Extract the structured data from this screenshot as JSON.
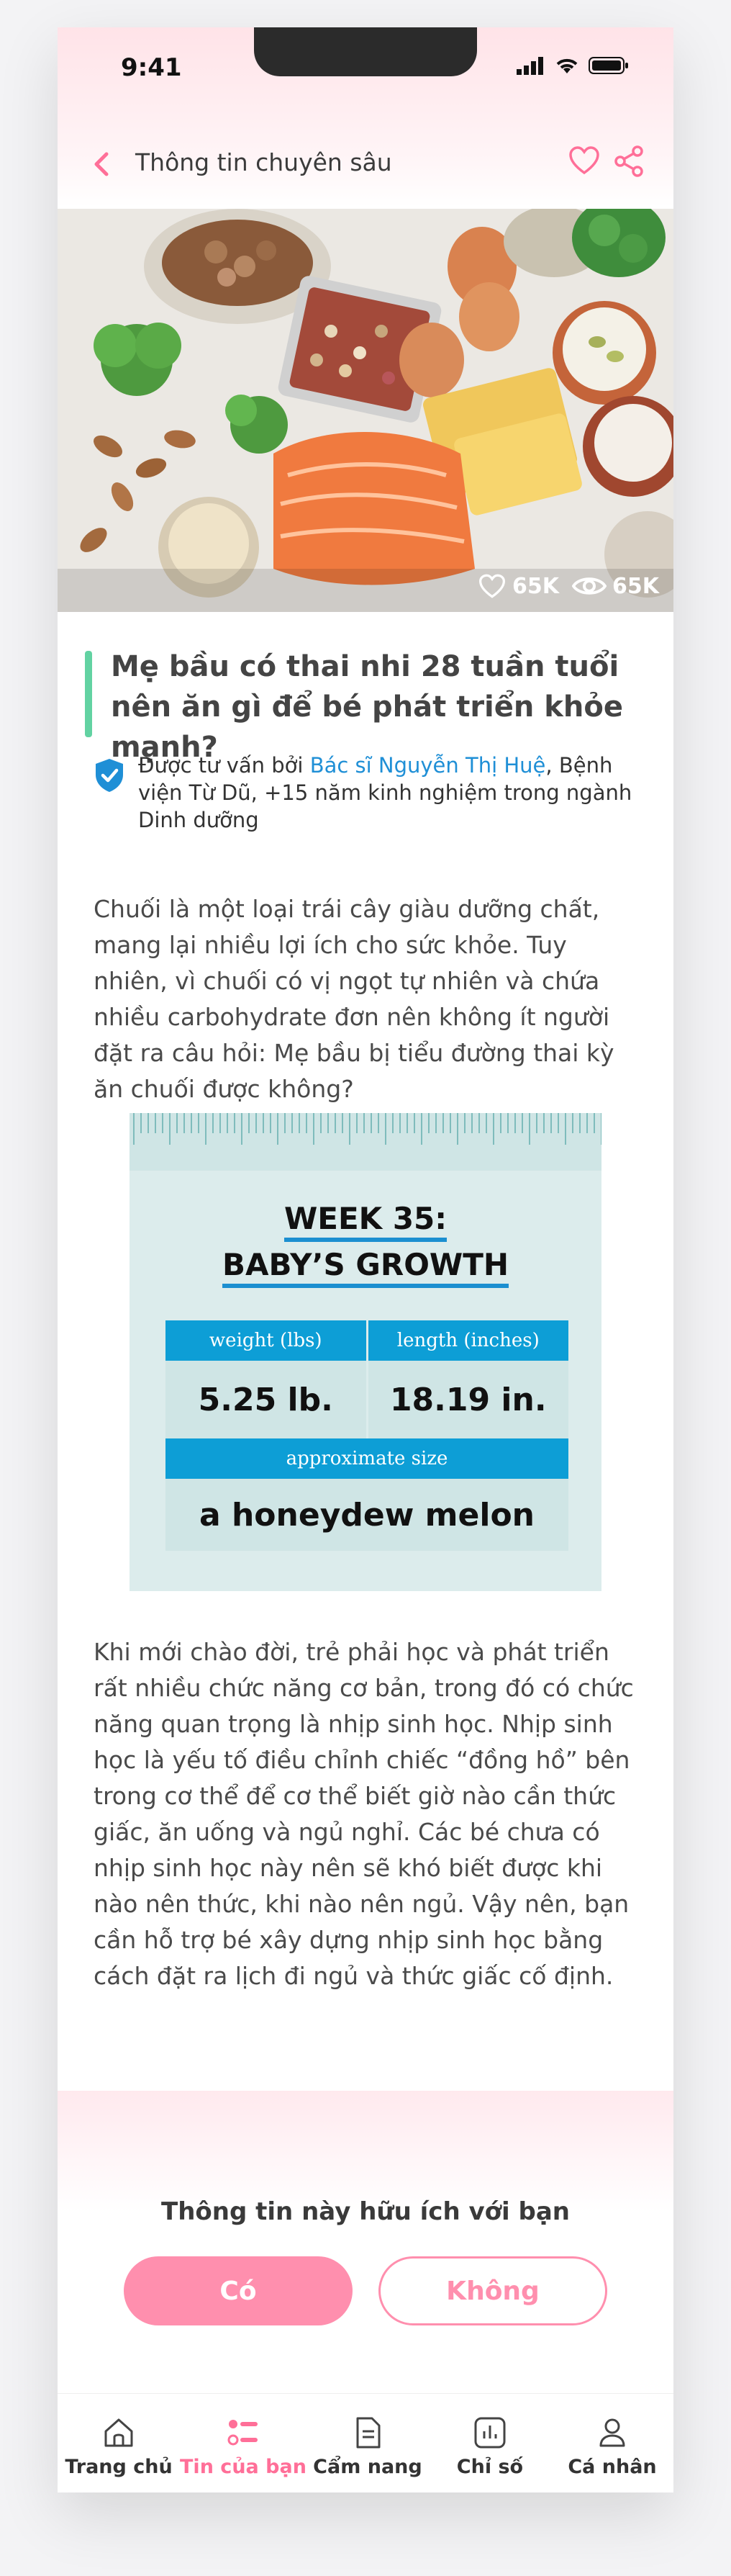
{
  "status_bar": {
    "time": "9:41"
  },
  "header": {
    "title": "Thông tin chuyên sâu"
  },
  "hero": {
    "likes": "65K",
    "views": "65K"
  },
  "article": {
    "title": "Mẹ bầu có thai nhi 28 tuần tuổi nên ăn gì để bé phát triển khỏe mạnh?",
    "advisor_prefix": "Được tư vấn bởi ",
    "advisor_name": "Bác sĩ Nguyễn Thị Huệ",
    "advisor_suffix": ", Bệnh viện Từ Dũ, +15 năm kinh nghiệm trong ngành Dinh dưỡng",
    "paragraph1": "Chuối là một loại trái cây giàu dưỡng chất, mang lại nhiều lợi ích cho sức khỏe. Tuy nhiên, vì chuối có vị ngọt tự nhiên và chứa nhiều carbohydrate đơn nên không ít người đặt ra câu hỏi: Mẹ bầu bị tiểu đường thai kỳ ăn chuối được không?",
    "paragraph2": "Khi mới chào đời, trẻ phải học và phát triển rất nhiều chức năng cơ bản, trong đó có chức năng quan trọng là nhịp sinh học. Nhịp sinh học là yếu tố điều chỉnh chiếc “đồng hồ” bên trong cơ thể để cơ thể biết giờ nào cần thức giấc, ăn uống và ngủ nghỉ. Các bé chưa có nhịp sinh học này nên sẽ khó biết được khi nào nên thức, khi nào nên ngủ. Vậy nên, bạn cần hỗ trợ bé xây dựng nhịp sinh học bằng cách đặt ra lịch đi ngủ và thức giấc cố định."
  },
  "infographic": {
    "title_line1": "WEEK 35:",
    "title_line2": "BABY’S GROWTH",
    "weight_label": "weight (lbs)",
    "length_label": "length (inches)",
    "weight_value": "5.25 lb.",
    "length_value": "18.19 in.",
    "approx_label": "approximate size",
    "approx_value": "a honeydew melon"
  },
  "feedback": {
    "question": "Thông tin này hữu ích với bạn",
    "yes_label": "Có",
    "no_label": "Không"
  },
  "nav": {
    "items": [
      {
        "label": "Trang chủ",
        "icon": "home-icon"
      },
      {
        "label": "Tin của bạn",
        "icon": "news-list-icon"
      },
      {
        "label": "Cẩm nang",
        "icon": "handbook-icon"
      },
      {
        "label": "Chỉ số",
        "icon": "chart-icon"
      },
      {
        "label": "Cá nhân",
        "icon": "user-icon"
      }
    ],
    "active_index": 1
  },
  "colors": {
    "accent_pink": "#ff8fae",
    "title_bar_green": "#62d2a2",
    "link_blue": "#1f8fd6",
    "info_blue": "#0d9ed6"
  }
}
